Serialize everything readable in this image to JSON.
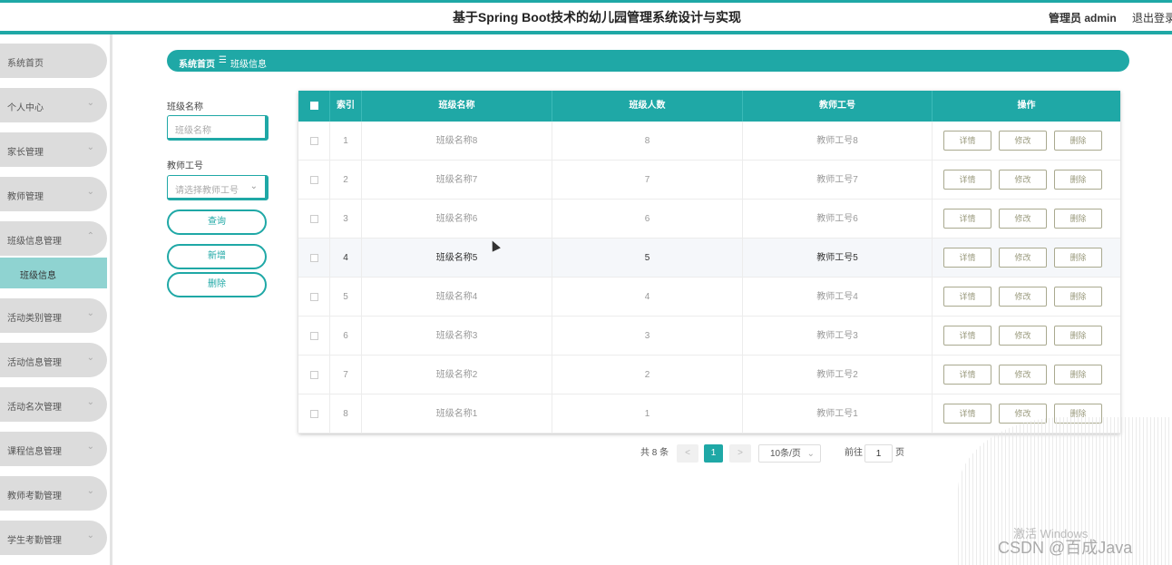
{
  "header": {
    "title": "基于Spring Boot技术的幼儿园管理系统设计与实现",
    "user": "管理员 admin",
    "logout": "退出登录"
  },
  "sidebar": {
    "items": [
      {
        "label": "系统首页",
        "chevron": ""
      },
      {
        "label": "个人中心",
        "chevron": "⌄"
      },
      {
        "label": "家长管理",
        "chevron": "⌄"
      },
      {
        "label": "教师管理",
        "chevron": "⌄"
      },
      {
        "label": "班级信息管理",
        "chevron": "⌃"
      },
      {
        "label": "活动类别管理",
        "chevron": "⌄"
      },
      {
        "label": "活动信息管理",
        "chevron": "⌄"
      },
      {
        "label": "活动名次管理",
        "chevron": "⌄"
      },
      {
        "label": "课程信息管理",
        "chevron": "⌄"
      },
      {
        "label": "教师考勤管理",
        "chevron": "⌄"
      },
      {
        "label": "学生考勤管理",
        "chevron": "⌄"
      }
    ],
    "submenu_active": "班级信息"
  },
  "breadcrumb": {
    "home": "系统首页",
    "separator": "☰",
    "current": "班级信息"
  },
  "filters": {
    "class_name_label": "班级名称",
    "class_name_placeholder": "班级名称",
    "teacher_id_label": "教师工号",
    "teacher_id_placeholder": "请选择教师工号",
    "query_button": "查询",
    "add_button": "新增",
    "delete_button": "删除"
  },
  "table": {
    "columns": [
      "索引",
      "班级名称",
      "班级人数",
      "教师工号",
      "操作"
    ],
    "rows": [
      {
        "index": "1",
        "name": "班级名称8",
        "count": "8",
        "teacher": "教师工号8"
      },
      {
        "index": "2",
        "name": "班级名称7",
        "count": "7",
        "teacher": "教师工号7"
      },
      {
        "index": "3",
        "name": "班级名称6",
        "count": "6",
        "teacher": "教师工号6"
      },
      {
        "index": "4",
        "name": "班级名称5",
        "count": "5",
        "teacher": "教师工号5"
      },
      {
        "index": "5",
        "name": "班级名称4",
        "count": "4",
        "teacher": "教师工号4"
      },
      {
        "index": "6",
        "name": "班级名称3",
        "count": "3",
        "teacher": "教师工号3"
      },
      {
        "index": "7",
        "name": "班级名称2",
        "count": "2",
        "teacher": "教师工号2"
      },
      {
        "index": "8",
        "name": "班级名称1",
        "count": "1",
        "teacher": "教师工号1"
      }
    ],
    "actions": {
      "detail": "详情",
      "edit": "修改",
      "delete": "删除"
    }
  },
  "pagination": {
    "total": "共 8 条",
    "prev": "<",
    "current_page": "1",
    "next": ">",
    "page_size": "10条/页",
    "goto_label": "前往",
    "goto_value": "1",
    "page_suffix": "页"
  },
  "watermark": {
    "activate": "激活 Windows",
    "csdn": "CSDN @百成Java"
  },
  "colors": {
    "accent": "#1fa8a6",
    "submenu_active": "#8fd3d1",
    "menu_bg": "#dcdcdc"
  }
}
